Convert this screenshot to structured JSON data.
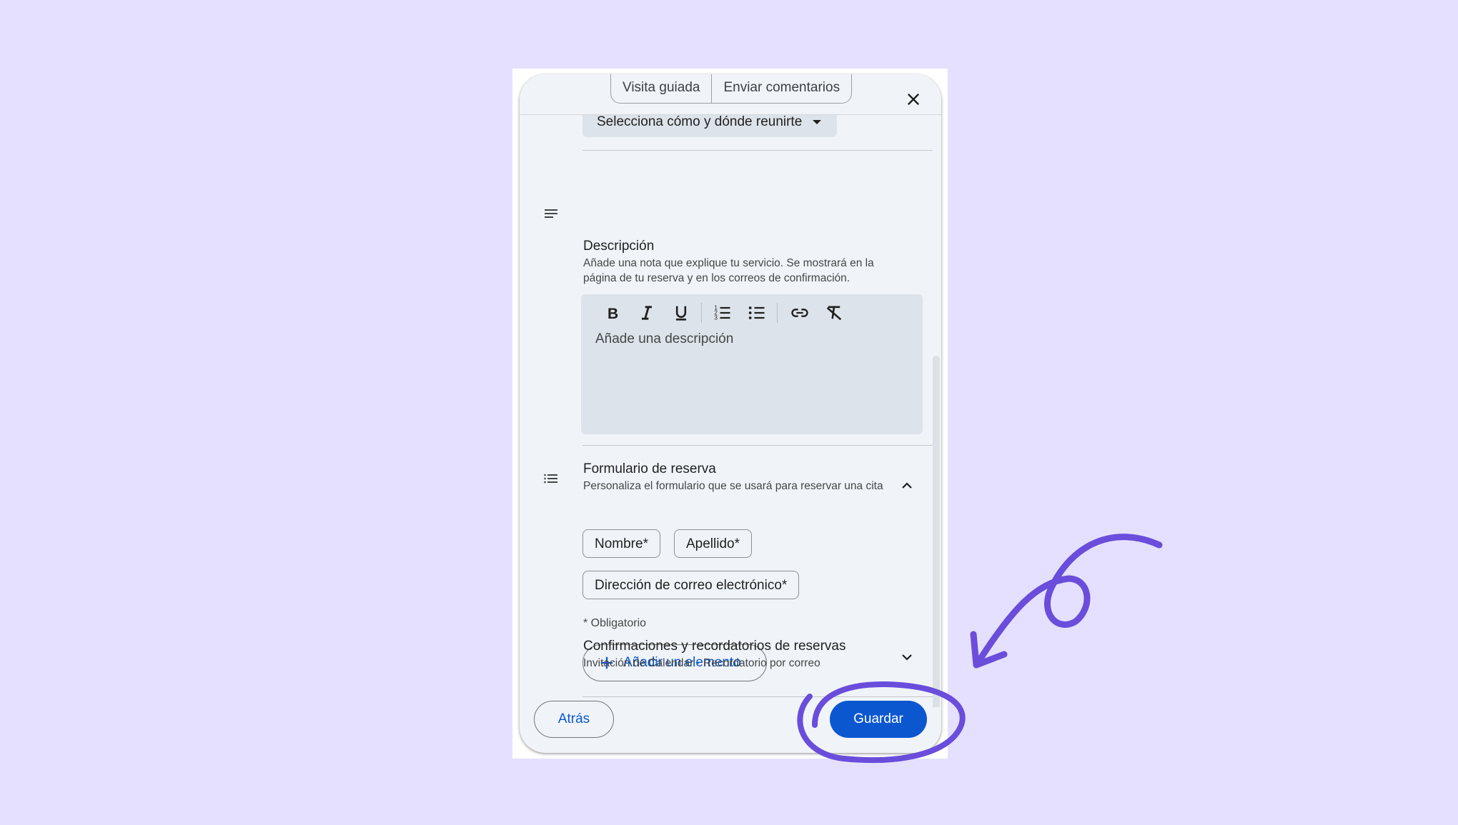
{
  "header": {
    "tabs": [
      {
        "label": "Visita guiada"
      },
      {
        "label": "Enviar comentarios"
      }
    ],
    "close_icon": "close-icon"
  },
  "location": {
    "select_value": "Selecciona cómo y dónde reunirte"
  },
  "description": {
    "title": "Descripción",
    "subtitle": "Añade una nota que explique tu servicio. Se mostrará en la página de tu reserva y en los correos de confirmación.",
    "placeholder": "Añade una descripción",
    "toolbar": [
      "bold-icon",
      "italic-icon",
      "underline-icon",
      "numbered-list-icon",
      "bulleted-list-icon",
      "link-icon",
      "clear-formatting-icon"
    ]
  },
  "booking_form": {
    "title": "Formulario de reserva",
    "subtitle": "Personaliza el formulario que se usará para reservar una cita",
    "fields": [
      {
        "label": "Nombre*"
      },
      {
        "label": "Apellido*"
      },
      {
        "label": "Dirección de correo electrónico*"
      }
    ],
    "required_note": "* Obligatorio",
    "add_button": "Añadir un elemento"
  },
  "confirmations": {
    "title": "Confirmaciones y recordatorios de reservas",
    "subtitle": "Invitación de Calendar · Recordatorio por correo"
  },
  "footer": {
    "back_label": "Atrás",
    "save_label": "Guardar"
  },
  "colors": {
    "background": "#e5e0ff",
    "panel": "#f0f4f9",
    "primary": "#0b57d0",
    "annotation": "#6a4ddb"
  }
}
